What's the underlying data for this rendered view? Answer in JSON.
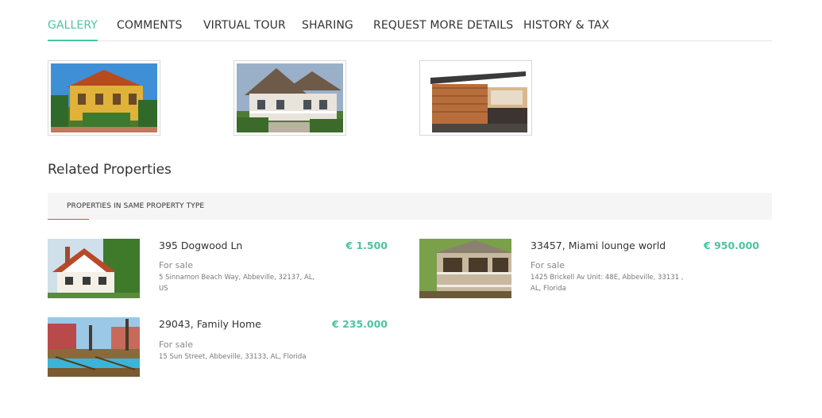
{
  "tabs": [
    {
      "label": "GALLERY",
      "active": true
    },
    {
      "label": "COMMENTS",
      "active": false
    },
    {
      "label": "VIRTUAL TOUR",
      "active": false
    },
    {
      "label": "SHARING",
      "active": false
    },
    {
      "label": "REQUEST MORE DETAILS",
      "active": false
    },
    {
      "label": "HISTORY & TAX",
      "active": false
    }
  ],
  "related": {
    "title": "Related Properties",
    "subtab_label": "PROPERTIES IN SAME PROPERTY TYPE",
    "properties": [
      {
        "title": "395 Dogwood Ln",
        "price": "€ 1.500",
        "status": "For sale",
        "address": "5 Sinnamon Beach Way, Abbeville, 32137, AL, US"
      },
      {
        "title": "33457, Miami lounge world",
        "price": "€ 950.000",
        "status": "For sale",
        "address": "1425 Brickell Av Unit: 48E, Abbeville, 33131 , AL, Florida"
      },
      {
        "title": "29043, Family Home",
        "price": "€ 235.000",
        "status": "For sale",
        "address": "15 Sun Street, Abbeville, 33133, AL, Florida"
      }
    ]
  },
  "colors": {
    "accent": "#4cc4a0",
    "underline_red": "#e24b4b"
  }
}
